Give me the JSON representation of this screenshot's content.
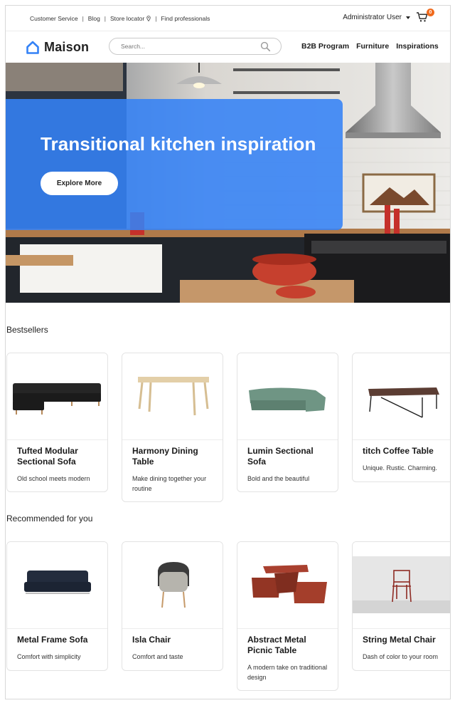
{
  "topbar": {
    "links": [
      "Customer Service",
      "Blog",
      "Store locator",
      "Find professionals"
    ],
    "separator": "|",
    "user": "Administrator User",
    "cart_count": "0"
  },
  "header": {
    "brand": "Maison",
    "search_placeholder": "Search...",
    "nav": [
      "B2B Program",
      "Furniture",
      "Inspirations"
    ]
  },
  "hero": {
    "title": "Transitional kitchen inspiration",
    "button": "Explore More"
  },
  "bestsellers": {
    "title": "Bestsellers",
    "items": [
      {
        "name": "Tufted Modular Sectional Sofa",
        "desc": "Old school meets modern"
      },
      {
        "name": "Harmony Dining Table",
        "desc": "Make dining together your routine"
      },
      {
        "name": "Lumin Sectional Sofa",
        "desc": "Bold and the beautiful"
      },
      {
        "name": "titch Coffee Table",
        "desc": "Unique. Rustic. Charming."
      }
    ]
  },
  "recommended": {
    "title": "Recommended for you",
    "items": [
      {
        "name": "Metal Frame Sofa",
        "desc": "Comfort with simplicity"
      },
      {
        "name": "Isla Chair",
        "desc": "Comfort and taste"
      },
      {
        "name": "Abstract Metal Picnic Table",
        "desc": "A modern take on traditional design"
      },
      {
        "name": "String Metal Chair",
        "desc": "Dash of color to your room"
      }
    ]
  },
  "colors": {
    "accent": "#3482f6",
    "badge": "#f06a1d"
  }
}
